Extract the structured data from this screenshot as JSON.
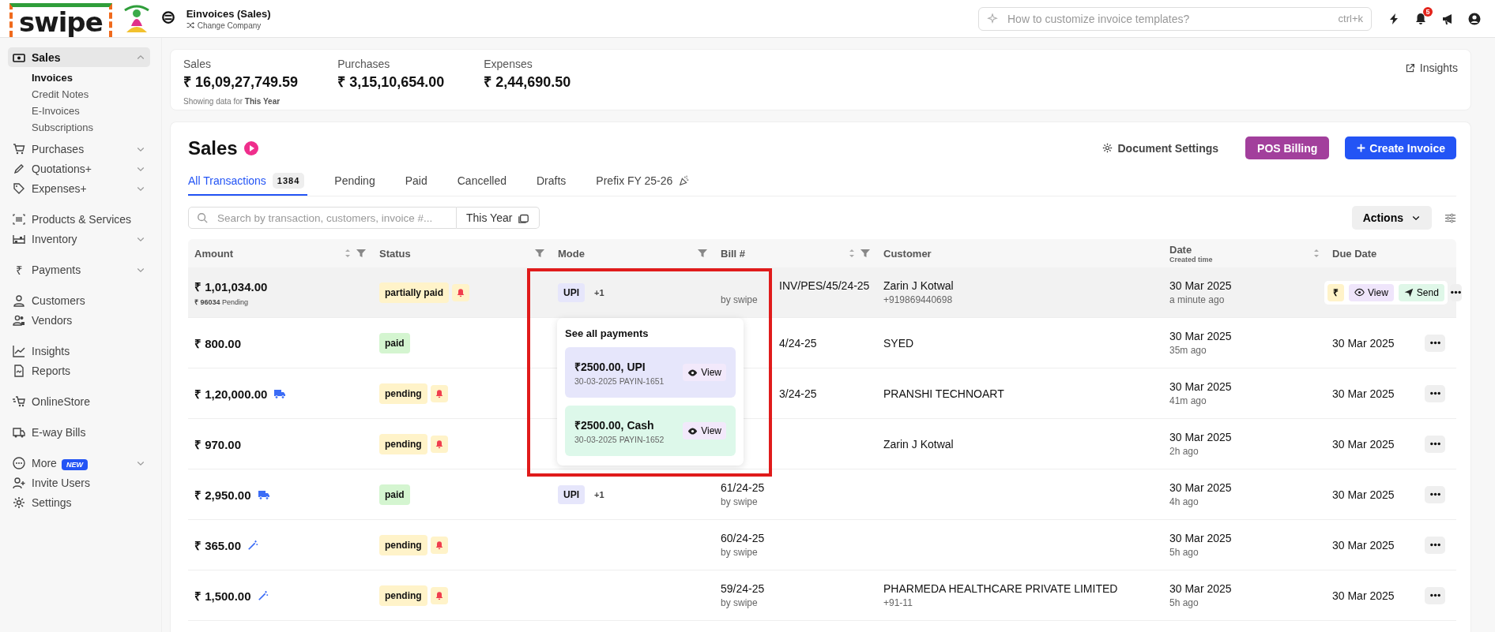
{
  "logo": {
    "text": "swipe"
  },
  "company": {
    "name": "Einvoices (Sales)",
    "switch_label": "Change Company"
  },
  "search": {
    "placeholder": "How to customize invoice templates?",
    "shortcut": "ctrl+k"
  },
  "notifications": {
    "count": "5"
  },
  "sidebar": {
    "groups": [
      [
        {
          "label": "Sales",
          "selected": true,
          "expanded": true,
          "children": [
            {
              "label": "Invoices",
              "selected": true
            },
            {
              "label": "Credit Notes",
              "selected": false
            },
            {
              "label": "E-Invoices",
              "selected": false
            },
            {
              "label": "Subscriptions",
              "selected": false
            }
          ]
        },
        {
          "label": "Purchases",
          "selected": false,
          "expanded": false
        },
        {
          "label": "Quotations+",
          "selected": false,
          "expanded": false
        },
        {
          "label": "Expenses+",
          "selected": false,
          "expanded": false
        }
      ],
      [
        {
          "label": "Products & Services",
          "selected": false
        },
        {
          "label": "Inventory",
          "selected": false,
          "expanded": false
        }
      ],
      [
        {
          "label": "Payments",
          "selected": false,
          "expanded": false,
          "symbol": "₹"
        }
      ],
      [
        {
          "label": "Customers",
          "selected": false
        },
        {
          "label": "Vendors",
          "selected": false
        }
      ],
      [
        {
          "label": "Insights",
          "selected": false
        },
        {
          "label": "Reports",
          "selected": false
        }
      ],
      [
        {
          "label": "OnlineStore",
          "selected": false
        }
      ],
      [
        {
          "label": "E-way Bills",
          "selected": false
        }
      ],
      [
        {
          "label": "More",
          "selected": false,
          "expanded": false,
          "badge": "NEW"
        },
        {
          "label": "Invite Users",
          "selected": false
        },
        {
          "label": "Settings",
          "selected": false
        }
      ]
    ]
  },
  "stats": {
    "items": [
      {
        "label": "Sales",
        "value": "₹ 16,09,27,749.59"
      },
      {
        "label": "Purchases",
        "value": "₹ 3,15,10,654.00"
      },
      {
        "label": "Expenses",
        "value": "₹ 2,44,690.50"
      }
    ],
    "note": "Showing data for **This Year**",
    "insights_link": "Insights"
  },
  "panel": {
    "title": "Sales",
    "document_settings": "Document Settings",
    "pos_button": "POS Billing",
    "create_button": "Create Invoice",
    "tabs": [
      {
        "label": "All Transactions",
        "count": "1384",
        "selected": true,
        "kind": "plain"
      },
      {
        "label": "Pending",
        "selected": false,
        "kind": "plain"
      },
      {
        "label": "Paid",
        "selected": false,
        "kind": "plain"
      },
      {
        "label": "Cancelled",
        "selected": false,
        "kind": "plain"
      },
      {
        "label": "Drafts",
        "selected": false,
        "kind": "plain"
      },
      {
        "label": "Prefix FY 25-26",
        "selected": false,
        "kind": "promo"
      }
    ],
    "search_placeholder": "Search by transaction, customers, invoice #...",
    "period": "This Year",
    "actions_menu": "Actions"
  },
  "table": {
    "columns": [
      {
        "label": "Amount",
        "sortable": true,
        "filter": true
      },
      {
        "label": "Status",
        "sortable": false,
        "filter": true
      },
      {
        "label": "Mode",
        "sortable": false,
        "filter": true
      },
      {
        "label": "Bill #",
        "sortable": true,
        "filter": true
      },
      {
        "label": "Customer",
        "sortable": false,
        "filter": false
      },
      {
        "label": "Date",
        "sublabel": "Created time",
        "sortable": true,
        "filter": false
      },
      {
        "label": "Due Date",
        "sortable": false,
        "filter": false
      }
    ],
    "rows": [
      {
        "hovered": true,
        "amount": "₹ 1,01,034.00",
        "pending_note": "**₹ 96034** Pending",
        "status": {
          "label": "partially paid",
          "color": "#fff3c9"
        },
        "reminder": true,
        "mode": "UPI",
        "mode_extra": "+1",
        "bill": "INV/PES/45/24-25",
        "bill_by": "by swipe",
        "customer": "Zarin J Kotwal",
        "phone": "+919869440698",
        "date": "30 Mar 2025",
        "ago": "a minute ago",
        "actions": {
          "pay": "₹",
          "view": "View",
          "send": "Send"
        },
        "payments_popup": {
          "title": "See all payments",
          "payments": [
            {
              "amount": "₹2500.00, UPI",
              "meta": "30-03-2025 PAYIN-1651",
              "action": "View",
              "color": "#e6e6fb"
            },
            {
              "amount": "₹2500.00, Cash",
              "meta": "30-03-2025 PAYIN-1652",
              "action": "View",
              "color": "#ddf8ea"
            }
          ]
        }
      },
      {
        "hovered": false,
        "amount": "₹ 800.00",
        "status": {
          "label": "paid",
          "color": "#d4f5d0"
        },
        "reminder": false,
        "bill": "4/24-25",
        "customer": "SYED",
        "date": "30 Mar 2025",
        "ago": "35m ago",
        "due_date": "30 Mar 2025"
      },
      {
        "hovered": false,
        "amount": "₹ 1,20,000.00",
        "eway_bill": true,
        "status": {
          "label": "pending",
          "color": "#fff3c9"
        },
        "reminder": true,
        "bill": "3/24-25",
        "customer": "PRANSHI TECHNOART",
        "date": "30 Mar 2025",
        "ago": "41m ago",
        "due_date": "30 Mar 2025"
      },
      {
        "hovered": false,
        "amount": "₹ 970.00",
        "status": {
          "label": "pending",
          "color": "#fff3c9"
        },
        "reminder": true,
        "customer": "Zarin J Kotwal",
        "date": "30 Mar 2025",
        "ago": "2h ago",
        "due_date": "30 Mar 2025"
      },
      {
        "hovered": false,
        "amount": "₹ 2,950.00",
        "eway_bill": true,
        "status": {
          "label": "paid",
          "color": "#d4f5d0"
        },
        "reminder": false,
        "mode": "UPI",
        "mode_extra": "+1",
        "bill": "61/24-25",
        "bill_by": "by swipe",
        "date": "30 Mar 2025",
        "ago": "4h ago",
        "due_date": "30 Mar 2025"
      },
      {
        "hovered": false,
        "amount": "₹ 365.00",
        "auto_created": true,
        "status": {
          "label": "pending",
          "color": "#fff3c9"
        },
        "reminder": true,
        "bill": "60/24-25",
        "bill_by": "by swipe",
        "date": "30 Mar 2025",
        "ago": "5h ago",
        "due_date": "30 Mar 2025"
      },
      {
        "hovered": false,
        "amount": "₹ 1,500.00",
        "auto_created": true,
        "status": {
          "label": "pending",
          "color": "#fff3c9"
        },
        "reminder": true,
        "bill": "59/24-25",
        "bill_by": "by swipe",
        "customer": "PHARMEDA HEALTHCARE PRIVATE LIMITED",
        "phone": "+91-11",
        "date": "30 Mar 2025",
        "ago": "5h ago",
        "due_date": "30 Mar 2025"
      }
    ]
  }
}
